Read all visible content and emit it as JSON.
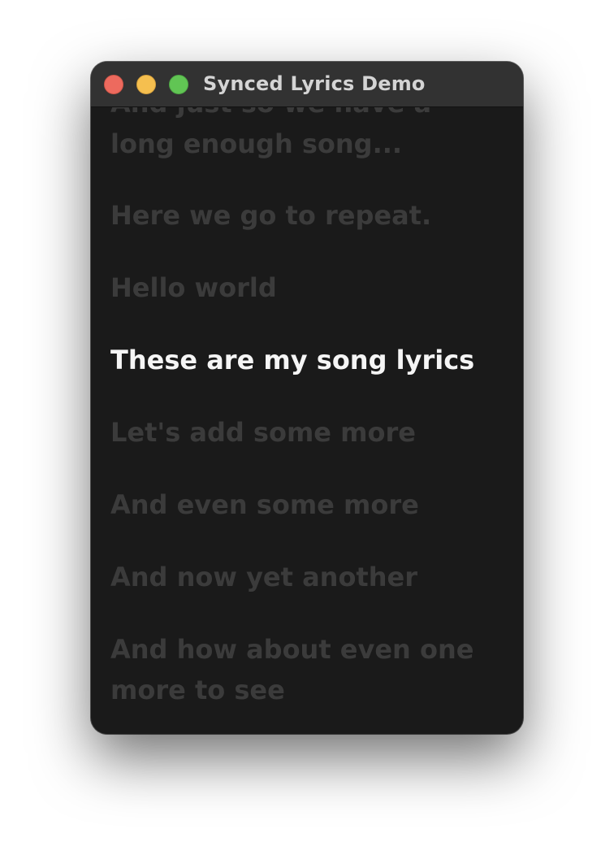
{
  "window": {
    "title": "Synced Lyrics Demo"
  },
  "lyrics": {
    "lines": [
      "And just so we have a long enough song...",
      "Here we go to repeat.",
      "Hello world",
      "These are my song lyrics",
      "Let's add some more",
      "And even some more",
      "And now yet another",
      "And how about even one more to see"
    ],
    "current_index": 3
  },
  "colors": {
    "window_background": "#1a1a1a",
    "titlebar_background": "#323232",
    "active_lyric": "#f5f5f5",
    "inactive_lyric": "#3b3b3b",
    "close": "#ed6a5e",
    "minimize": "#f5bf4f",
    "zoom": "#61c554"
  },
  "icons": {
    "close": "close-icon",
    "minimize": "minimize-icon",
    "zoom": "zoom-icon"
  }
}
